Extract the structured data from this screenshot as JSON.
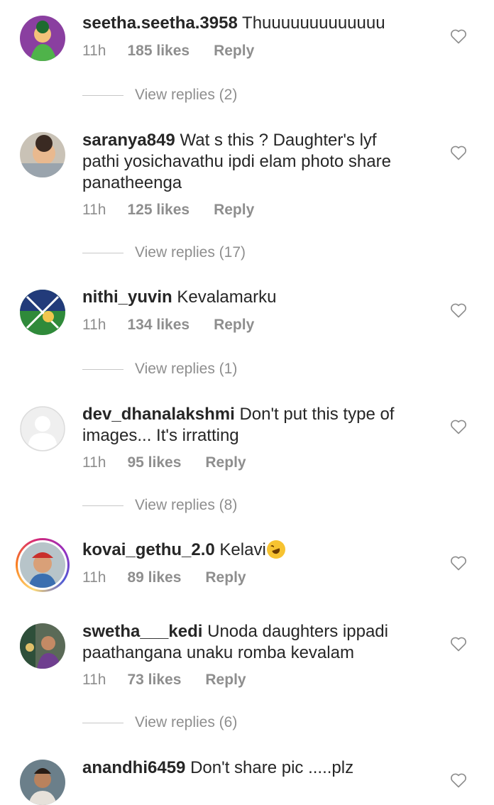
{
  "comments": [
    {
      "username": "seetha.seetha.3958",
      "text": "Thuuuuuuuuuuuuu",
      "time": "11h",
      "likes": "185 likes",
      "reply": "Reply",
      "view_replies": "View replies (2)"
    },
    {
      "username": "saranya849",
      "text": "Wat s this ? Daughter's lyf pathi yosichavathu ipdi elam photo share panatheenga",
      "time": "11h",
      "likes": "125 likes",
      "reply": "Reply",
      "view_replies": "View replies (17)"
    },
    {
      "username": "nithi_yuvin",
      "text": "Kevalamarku",
      "time": "11h",
      "likes": "134 likes",
      "reply": "Reply",
      "view_replies": "View replies (1)"
    },
    {
      "username": "dev_dhanalakshmi",
      "text": "Don't put this type of images... It's irratting",
      "time": "11h",
      "likes": "95 likes",
      "reply": "Reply",
      "view_replies": "View replies (8)"
    },
    {
      "username": "kovai_gethu_2.0",
      "text": "Kelavi",
      "emoji": "rolling-on-floor-laughing",
      "time": "11h",
      "likes": "89 likes",
      "reply": "Reply"
    },
    {
      "username": "swetha___kedi",
      "text": "Unoda daughters ippadi paathangana unaku romba kevalam",
      "time": "11h",
      "likes": "73 likes",
      "reply": "Reply",
      "view_replies": "View replies (6)"
    },
    {
      "username": "anandhi6459",
      "text": "Don't share pic .....plz"
    }
  ],
  "icons": {
    "like": "heart-outline-icon",
    "default_avatar": "default-avatar-icon"
  },
  "colors": {
    "text": "#262626",
    "meta": "#8e8e8e",
    "story_ring": [
      "#feda75",
      "#fa7e1e",
      "#d62976",
      "#962fbf",
      "#4f5bd5"
    ]
  }
}
